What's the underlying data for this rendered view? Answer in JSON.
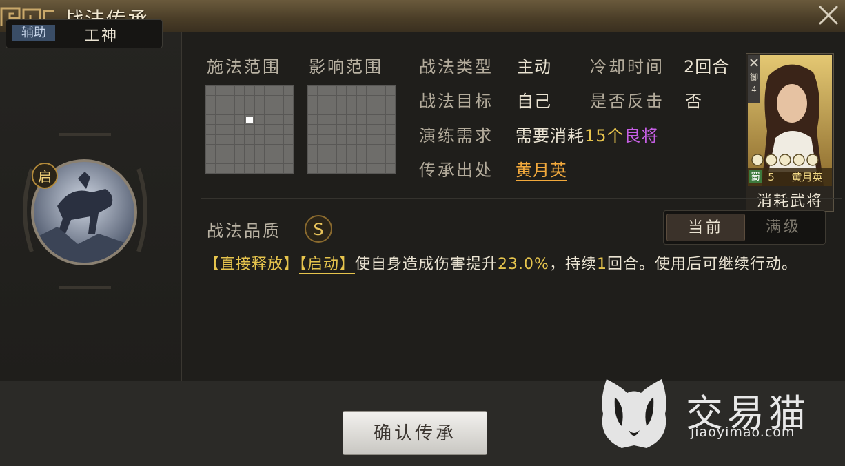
{
  "window": {
    "title": "战法传承"
  },
  "left": {
    "type_tag": "辅助",
    "skill_name": "工神",
    "badge": "启"
  },
  "ranges": {
    "cast_label": "施法范围",
    "effect_label": "影响范围",
    "cast_grid_active_cell": [
      4,
      3
    ]
  },
  "info": {
    "type_label": "战法类型",
    "type_value": "主动",
    "cooldown_label": "冷却时间",
    "cooldown_value": "2回合",
    "target_label": "战法目标",
    "target_value": "自己",
    "counter_label": "是否反击",
    "counter_value": "否",
    "practice_label": "演练需求",
    "practice_prefix": "需要消耗",
    "practice_count": "15个",
    "practice_item": "良将",
    "source_label": "传承出处",
    "source_value": "黄月英"
  },
  "card": {
    "rank_label": "御",
    "rank_num": "4",
    "faction": "蜀",
    "cost": "5",
    "hero_name": "黄月英",
    "caption": "消耗武将",
    "stars": 5
  },
  "quality": {
    "label": "战法品质",
    "grade": "S"
  },
  "toggle": {
    "current": "当前",
    "max": "满级",
    "selected": "current"
  },
  "description": {
    "tag1": "【直接释放】",
    "tag2": "【启动】",
    "text1": "使自身造成伤害提升",
    "value": "23.0%",
    "text2": "，持续",
    "duration": "1",
    "text3": "回合。使用后可继续行动。"
  },
  "confirm_button": "确认传承",
  "watermark": {
    "brand": "交易猫",
    "url": "jiaoyimao.com"
  },
  "colors": {
    "accent_gold": "#e6c44d",
    "accent_purple": "#c65fe4",
    "accent_orange": "#f2a93c"
  }
}
